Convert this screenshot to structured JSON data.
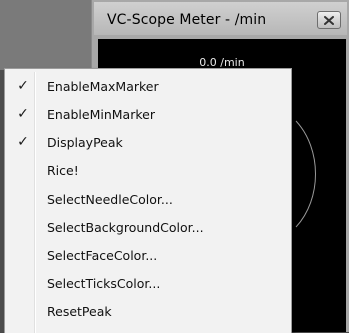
{
  "window": {
    "title": "VC-Scope Meter - /min",
    "readout": "0.0 /min"
  },
  "menu": {
    "items": [
      {
        "label": "EnableMaxMarker",
        "checked": true
      },
      {
        "label": "EnableMinMarker",
        "checked": true
      },
      {
        "label": "DisplayPeak",
        "checked": true
      },
      {
        "label": "Rice!",
        "checked": false
      },
      {
        "label": "SelectNeedleColor...",
        "checked": false
      },
      {
        "label": "SelectBackgroundColor...",
        "checked": false
      },
      {
        "label": "SelectFaceColor...",
        "checked": false
      },
      {
        "label": "SelectTicksColor...",
        "checked": false
      },
      {
        "label": "ResetPeak",
        "checked": false
      }
    ],
    "check_glyph": "✓"
  }
}
